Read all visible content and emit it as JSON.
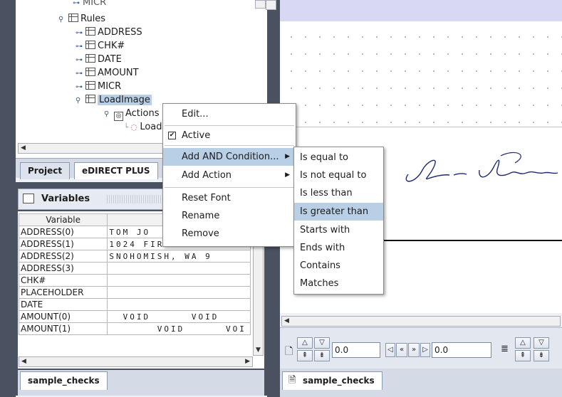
{
  "tree": {
    "partial_top": "MICR",
    "rules_label": "Rules",
    "rule_items": [
      "ADDRESS",
      "CHK#",
      "DATE",
      "AMOUNT",
      "MICR",
      "LoadImage"
    ],
    "actions_label": "Actions",
    "load_label": "Load"
  },
  "left_tabs": {
    "project": "Project",
    "edirect": "eDIRECT PLUS"
  },
  "variables_panel": {
    "title": "Variables",
    "column_header": "Variable",
    "rows": [
      {
        "name": "ADDRESS(0)",
        "value": "TOM JO"
      },
      {
        "name": "ADDRESS(1)",
        "value": "1024 FIRST STREE"
      },
      {
        "name": "ADDRESS(2)",
        "value": "SNOHOMISH, WA   9"
      },
      {
        "name": "ADDRESS(3)",
        "value": ""
      },
      {
        "name": "CHK#",
        "value": ""
      },
      {
        "name": "PLACEHOLDER",
        "value": ""
      },
      {
        "name": "DATE",
        "value": ""
      },
      {
        "name": "AMOUNT(0)",
        "value": "  VOID      VOID"
      },
      {
        "name": "AMOUNT(1)",
        "value": "       VOID      VOI"
      }
    ]
  },
  "context_menu": {
    "edit": "Edit...",
    "active": "Active",
    "add_and_condition": "Add AND Condition...",
    "add_action": "Add Action",
    "reset_font": "Reset Font",
    "rename": "Rename",
    "remove": "Remove"
  },
  "condition_submenu": [
    "Is equal to",
    "Is not equal to",
    "Is less than",
    "Is greater than",
    "Starts with",
    "Ends with",
    "Contains",
    "Matches"
  ],
  "bottom_tabs": {
    "left": "sample_checks",
    "right": "sample_checks"
  },
  "toolbar": {
    "field1": "0.0",
    "field2": "0.0"
  },
  "colors": {
    "accent": "#b8cfe5",
    "frame": "#4a5160",
    "canvas_top": "#d8d8f4"
  }
}
